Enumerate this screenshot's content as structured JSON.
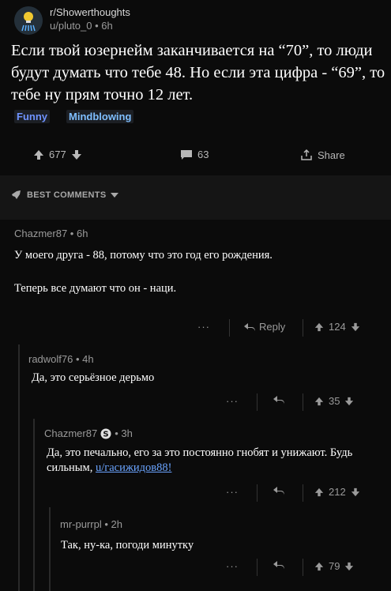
{
  "post": {
    "subreddit": "r/Showerthoughts",
    "author_meta": "u/pluto_0 • 6h",
    "title": "Если твой юзернейм заканчивается на “70”, то люди будут думать что тебе 48. Но если эта цифра - “69”, то тебе ну прям точно 12 лет.",
    "flairs": [
      "Funny",
      "Mindblowing"
    ],
    "score": "677",
    "comments_count": "63",
    "share_label": "Share"
  },
  "section": {
    "best_comments_label": "BEST COMMENTS"
  },
  "comments": [
    {
      "meta": "Chazmer87 • 6h",
      "body_1": "У моего друга - 88, потому что это год его рождения.",
      "body_2": "Теперь все думают что он - наци.",
      "more": "···",
      "reply_label": "Reply",
      "score": "124"
    },
    {
      "meta": "radwolf76 • 4h",
      "body": "Да, это серьёзное дерьмо",
      "more": "···",
      "score": "35"
    },
    {
      "author": "Chazmer87",
      "time": "• 3h",
      "body_text": "Да, это печально, его за это постоянно гнобят и унижают. Будь сильным, ",
      "body_link": "u/гасижидов88!",
      "more": "···",
      "score": "212"
    },
    {
      "meta": "mr-purrpl • 2h",
      "body": "Так, ну-ка, погоди минутку",
      "more": "···",
      "score": "79"
    }
  ],
  "colors": {
    "background": "#0b0b0b",
    "flair_funny": "#6f93ff",
    "flair_mindblowing": "#7fbfff",
    "link": "#6aa4ff"
  }
}
